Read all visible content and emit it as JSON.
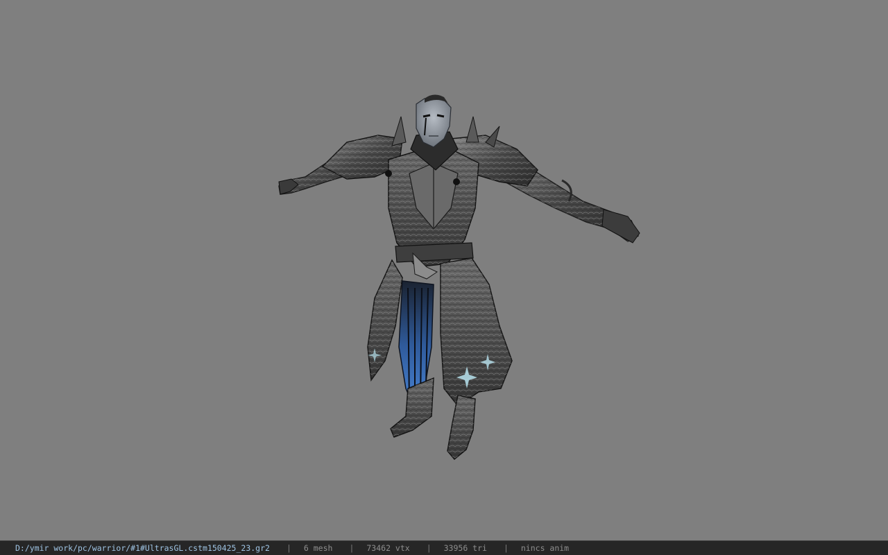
{
  "viewport": {
    "background_color": "#7f7f7f",
    "model": {
      "subject": "armored-warrior-character-tpose"
    }
  },
  "status_bar": {
    "path": "D:/ymir work/pc/warrior/#1#UltrasGL.cstm150425_23.gr2",
    "separator": "|",
    "mesh": "6 mesh",
    "vertices": "73462 vtx",
    "triangles": "33956 tri",
    "anim": "nincs anim",
    "path_color": "#9fc4e4",
    "background_color": "#262626"
  }
}
